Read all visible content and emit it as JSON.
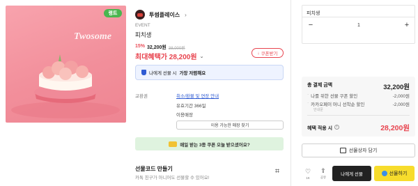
{
  "product": {
    "image_stamp": "랭트",
    "image_brand_text": "Twosome",
    "brand": "투썸플레이스",
    "event_tag": "EVENT",
    "title": "피치생",
    "discount": "15%",
    "price": "32,200원",
    "original_price": "38,000원",
    "max_benefit": "최대혜택가 28,200원",
    "coupon_button": "쿠폰받기",
    "notice_prefix": "나에게 선물 시",
    "notice_bold": "가장 저렴해요"
  },
  "info": {
    "exchange_label": "교환권",
    "exchange_link": "취소/환불 및 연장 안내",
    "validity": "유효기간 366일",
    "stores_label": "이용매장",
    "stores_button": "이용 가능한 매장 찾기"
  },
  "promo": {
    "text": "매일 받는 3종 쿠폰 오늘 받으셨어요?"
  },
  "barcode": {
    "title": "선물코드 만들기",
    "desc": "카톡 친구가 아니어도 선물할 수 있어요!"
  },
  "option": {
    "label": "피치생",
    "quantity": "1"
  },
  "summary": {
    "total_label": "총 결제 금액",
    "total_amount": "32,200원",
    "line1_label": "나를 위한 선물 쿠폰 할인",
    "line1_amount": "-2,000원",
    "line2_label": "카카오페이 머니 선착순 할인",
    "line2_amount": "-2,000원",
    "line2_sub": "안내문",
    "final_label": "혜택 적용 시",
    "final_amount": "28,200원"
  },
  "actions": {
    "gift_box": "선물상자 담기",
    "like_count": "1K",
    "share": "공유",
    "gift_me": "나에게 선물",
    "gift": "선물하기"
  },
  "colors": {
    "accent_red": "#e8434e",
    "kakao_yellow": "#f7dc2c",
    "link_blue": "#2f5bd3"
  }
}
